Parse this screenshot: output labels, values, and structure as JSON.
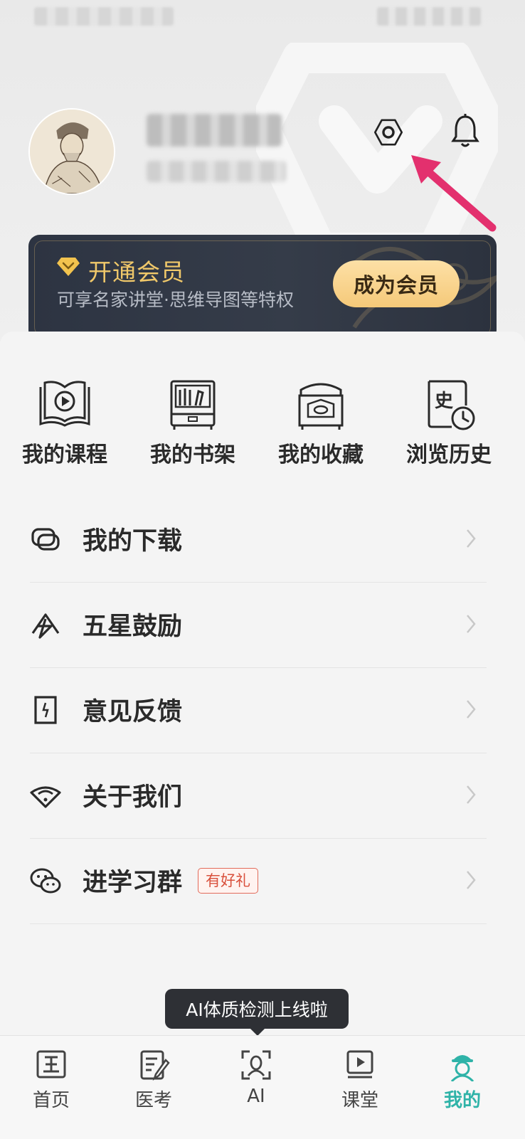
{
  "header": {
    "user_name_blurred": "",
    "user_subtitle_blurred": ""
  },
  "vip": {
    "title": "开通会员",
    "description": "可享名家讲堂·思维导图等特权",
    "button": "成为会员"
  },
  "quick_links": [
    {
      "label": "我的课程",
      "icon": "course-book-play-icon"
    },
    {
      "label": "我的书架",
      "icon": "bookshelf-icon"
    },
    {
      "label": "我的收藏",
      "icon": "collection-box-icon"
    },
    {
      "label": "浏览历史",
      "icon": "history-clock-icon"
    }
  ],
  "menu": [
    {
      "label": "我的下载",
      "icon": "download-icon"
    },
    {
      "label": "五星鼓励",
      "icon": "five-star-rate-icon"
    },
    {
      "label": "意见反馈",
      "icon": "feedback-icon"
    },
    {
      "label": "关于我们",
      "icon": "about-us-icon"
    },
    {
      "label": "进学习群",
      "icon": "wechat-group-icon",
      "badge": "有好礼"
    }
  ],
  "tooltip": "AI体质检测上线啦",
  "tabs": [
    {
      "label": "首页",
      "icon": "home-icon"
    },
    {
      "label": "医考",
      "icon": "exam-icon"
    },
    {
      "label": "AI",
      "icon": "ai-scan-icon"
    },
    {
      "label": "课堂",
      "icon": "classroom-icon"
    },
    {
      "label": "我的",
      "icon": "profile-icon",
      "active": true
    }
  ],
  "colors": {
    "accent_teal": "#2fb3a8",
    "vip_gold": "#f0c86a",
    "arrow_pink": "#e3306e",
    "badge_red": "#d9503c"
  }
}
